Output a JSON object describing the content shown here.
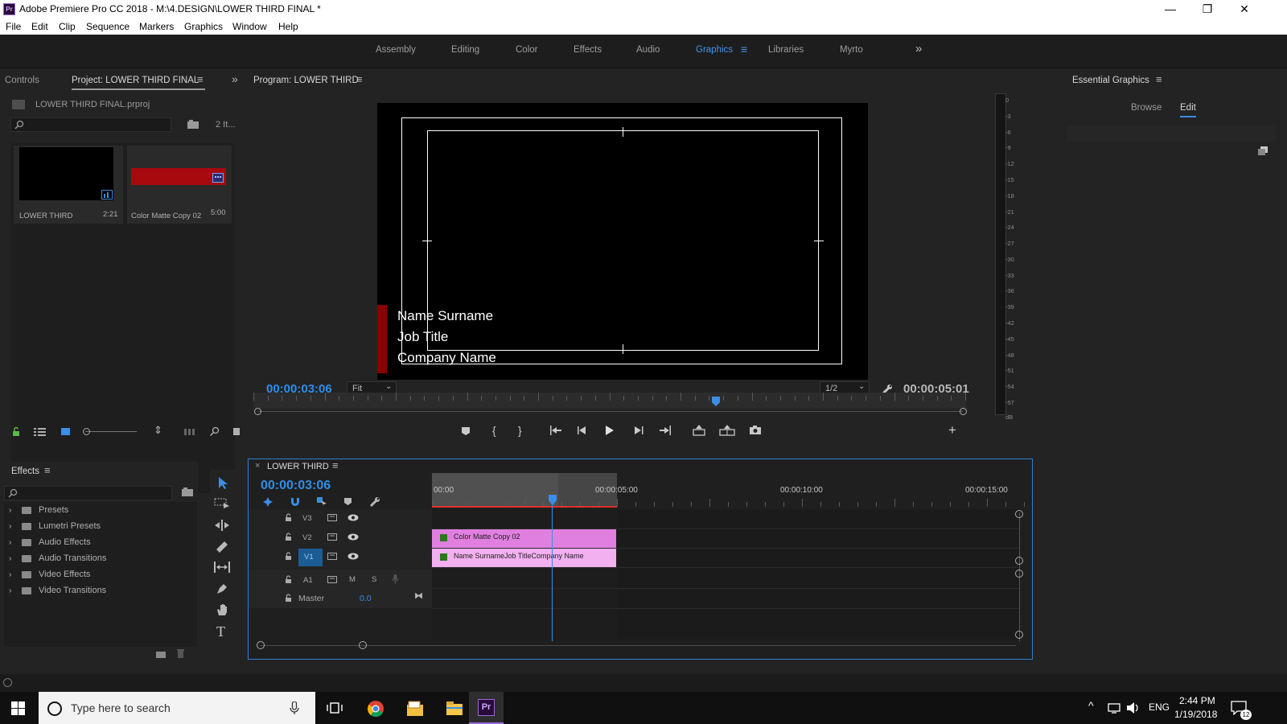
{
  "window": {
    "app_icon": "Pr",
    "title": "Adobe Premiere Pro CC 2018 - M:\\4.DESIGN\\LOWER THIRD FINAL *",
    "minimize": "—",
    "maximize": "❐",
    "close": "✕"
  },
  "menu": [
    "File",
    "Edit",
    "Clip",
    "Sequence",
    "Markers",
    "Graphics",
    "Window",
    "Help"
  ],
  "workspaces": [
    "Assembly",
    "Editing",
    "Color",
    "Effects",
    "Audio",
    "Graphics",
    "Libraries",
    "Myrto"
  ],
  "workspace_active": "Graphics",
  "workspace_overflow": "»",
  "project_panel": {
    "tab_controls": "Controls",
    "tab_project": "Project: LOWER THIRD FINAL",
    "file": "LOWER THIRD FINAL.prproj",
    "search_placeholder": "",
    "items_count": "2 It...",
    "items": [
      {
        "name": "LOWER THIRD",
        "duration": "2:21"
      },
      {
        "name": "Color Matte Copy 02",
        "duration": "5:00"
      }
    ]
  },
  "program_monitor": {
    "title": "Program: LOWER THIRD",
    "lower_third_lines": [
      "Name Surname",
      "Job Title",
      "Company Name"
    ],
    "timecode": "00:00:03:06",
    "zoom": "Fit",
    "resolution": "1/2",
    "duration": "00:00:05:01"
  },
  "vu_meter": {
    "labels": [
      "0",
      "-3",
      "-6",
      "-9",
      "-12",
      "-15",
      "-18",
      "-21",
      "-24",
      "-27",
      "-30",
      "-33",
      "-36",
      "-39",
      "-42",
      "-45",
      "-48",
      "-51",
      "-54",
      "-57",
      "dB"
    ]
  },
  "essential_graphics": {
    "title": "Essential Graphics",
    "tab_browse": "Browse",
    "tab_edit": "Edit"
  },
  "effects_panel": {
    "title": "Effects",
    "folders": [
      "Presets",
      "Lumetri Presets",
      "Audio Effects",
      "Audio Transitions",
      "Video Effects",
      "Video Transitions"
    ]
  },
  "timeline": {
    "title": "LOWER THIRD",
    "timecode": "00:00:03:06",
    "ruler": [
      "00:00",
      "00:00:05:00",
      "00:00:10:00",
      "00:00:15:00"
    ],
    "tracks": [
      "V3",
      "V2",
      "V1",
      "A1"
    ],
    "mute": "M",
    "solo": "S",
    "master_label": "Master",
    "master_value": "0.0",
    "clips": [
      {
        "name": "Color Matte Copy 02",
        "color": "#e17fe0"
      },
      {
        "name": "Name SurnameJob TitleCompany Name",
        "color": "#f2b0f0"
      }
    ]
  },
  "taskbar": {
    "search_placeholder": "Type here to search",
    "lang": "ENG",
    "time": "2:44 PM",
    "date": "1/19/2018",
    "notifications": "12"
  },
  "colors": {
    "accent": "#2f8ee8",
    "clip_pink": "#e17fe0",
    "lower_third_bar": "#8b0000",
    "playhead": "#3a8ee6"
  }
}
